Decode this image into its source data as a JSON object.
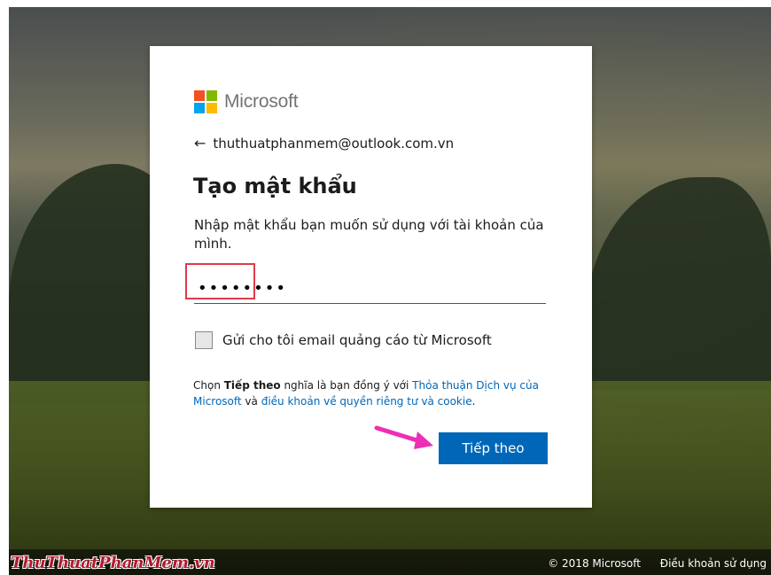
{
  "brand": {
    "name": "Microsoft",
    "colors": [
      "#f25022",
      "#7fba00",
      "#00a4ef",
      "#ffb900"
    ]
  },
  "identity": {
    "email": "thuthuatphanmem@outlook.com.vn",
    "back_icon": "arrow-left-icon"
  },
  "form": {
    "title": "Tạo mật khẩu",
    "description": "Nhập mật khẩu bạn muốn sử dụng với tài khoản của mình.",
    "password_value": "••••••••",
    "marketing_checkbox_label": "Gửi cho tôi email quảng cáo từ Microsoft",
    "marketing_checked": false,
    "terms": {
      "prefix": "Chọn ",
      "bold": "Tiếp theo",
      "middle": " nghĩa là bạn đồng ý với ",
      "link1": "Thỏa thuận Dịch vụ của Microsoft",
      "and": " và ",
      "link2": "điều khoản về quyền riêng tư và cookie",
      "suffix": "."
    },
    "next_button": "Tiếp theo",
    "accent_color": "#0067b8"
  },
  "footer": {
    "copyright": "© 2018 Microsoft",
    "terms": "Điều khoản sử dụng"
  },
  "watermark": "ThuThuatPhanMem.vn"
}
